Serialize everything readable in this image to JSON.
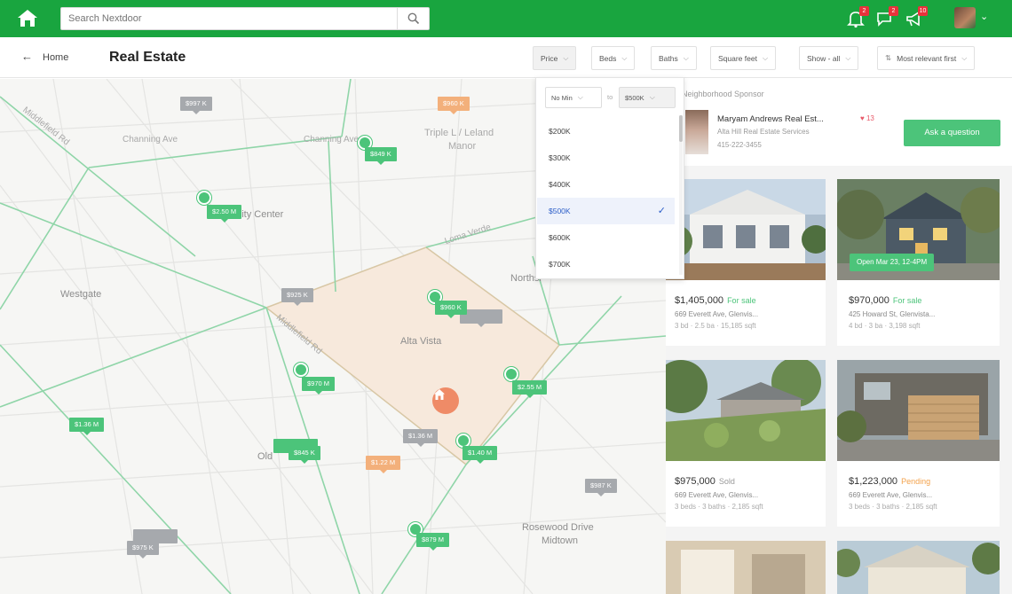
{
  "topbar": {
    "search_placeholder": "Search Nextdoor",
    "notifications": [
      {
        "name": "bell-icon",
        "count": "2"
      },
      {
        "name": "chat-icon",
        "count": "2"
      },
      {
        "name": "megaphone-icon",
        "count": "10"
      }
    ]
  },
  "subbar": {
    "back_label": "Home",
    "title": "Real Estate",
    "filters": {
      "price": "Price",
      "beds": "Beds",
      "baths": "Baths",
      "sqft": "Square feet",
      "show": "Show - all",
      "sort": "Most relevant first"
    }
  },
  "dropdown": {
    "min_value": "No Min",
    "to_label": "to",
    "max_value": "$500K",
    "options": [
      "$200K",
      "$300K",
      "$400K",
      "$500K",
      "$600K",
      "$700K"
    ],
    "selected": "$500K"
  },
  "map": {
    "streets": {
      "channing": "Channing Ave",
      "channing2": "Channing Ave",
      "middlefield": "Middlefield Rd",
      "middlefield2": "Middlefield Rd",
      "triple_l": "Triple L / Leland",
      "manor": "Manor",
      "loma_verde": "Loma Verde"
    },
    "places": {
      "community": "unity Center",
      "westgate": "Westgate",
      "alta_vista": "Alta Vista",
      "northside": "Northsi",
      "old_town": "Old",
      "rosewood": "Rosewood Drive",
      "midtown": "Midtown"
    },
    "pins": {
      "p1": "$997 K",
      "p2": "$960 K",
      "p3": "$849 K",
      "p4": "$2.50 M",
      "p5": "$925 K",
      "p6": "$960 K",
      "p7": "$970 M",
      "p8": "$2.55 M",
      "p9": "$1.36 M",
      "p10": "$845 K",
      "p11": "$1.36 M",
      "p12": "$1.22 M",
      "p13": "$1.40 M",
      "p14": "$987 K",
      "p15": "$975 K",
      "p16": "$879 M"
    }
  },
  "sponsor": {
    "title": "Neighborhood Sponsor",
    "name": "Maryam Andrews Real Est...",
    "likes": "♥ 13",
    "company": "Alta Hill Real Estate Services",
    "phone": "415-222-3455",
    "cta": "Ask a question"
  },
  "listings": [
    {
      "price": "$1,405,000",
      "status": "For sale",
      "status_color": "#4cc47a",
      "address": "669 Everett Ave, Glenvis...",
      "meta": "3 bd · 2.5 ba · 15,185 sqft",
      "tag": ""
    },
    {
      "price": "$970,000",
      "status": "For sale",
      "status_color": "#4cc47a",
      "address": "425 Howard St, Glenvista...",
      "meta": "4 bd · 3 ba · 3,198 sqft",
      "tag": "Open Mar 23, 12-4PM"
    },
    {
      "price": "$975,000",
      "status": "Sold",
      "status_color": "#999999",
      "address": "669 Everett Ave, Glenvis...",
      "meta": "3 beds · 3 baths · 2,185 sqft",
      "tag": ""
    },
    {
      "price": "$1,223,000",
      "status": "Pending",
      "status_color": "#f3a24c",
      "address": "669 Everett Ave, Glenvis...",
      "meta": "3 beds · 3 baths · 2,185 sqft",
      "tag": ""
    }
  ],
  "colors": {
    "brand_green": "#19a53f",
    "pin_green": "#4cc47a",
    "pin_gray": "#a6a9ad",
    "pin_orange": "#f3b07b",
    "selected_blue": "#2c5ec8"
  }
}
